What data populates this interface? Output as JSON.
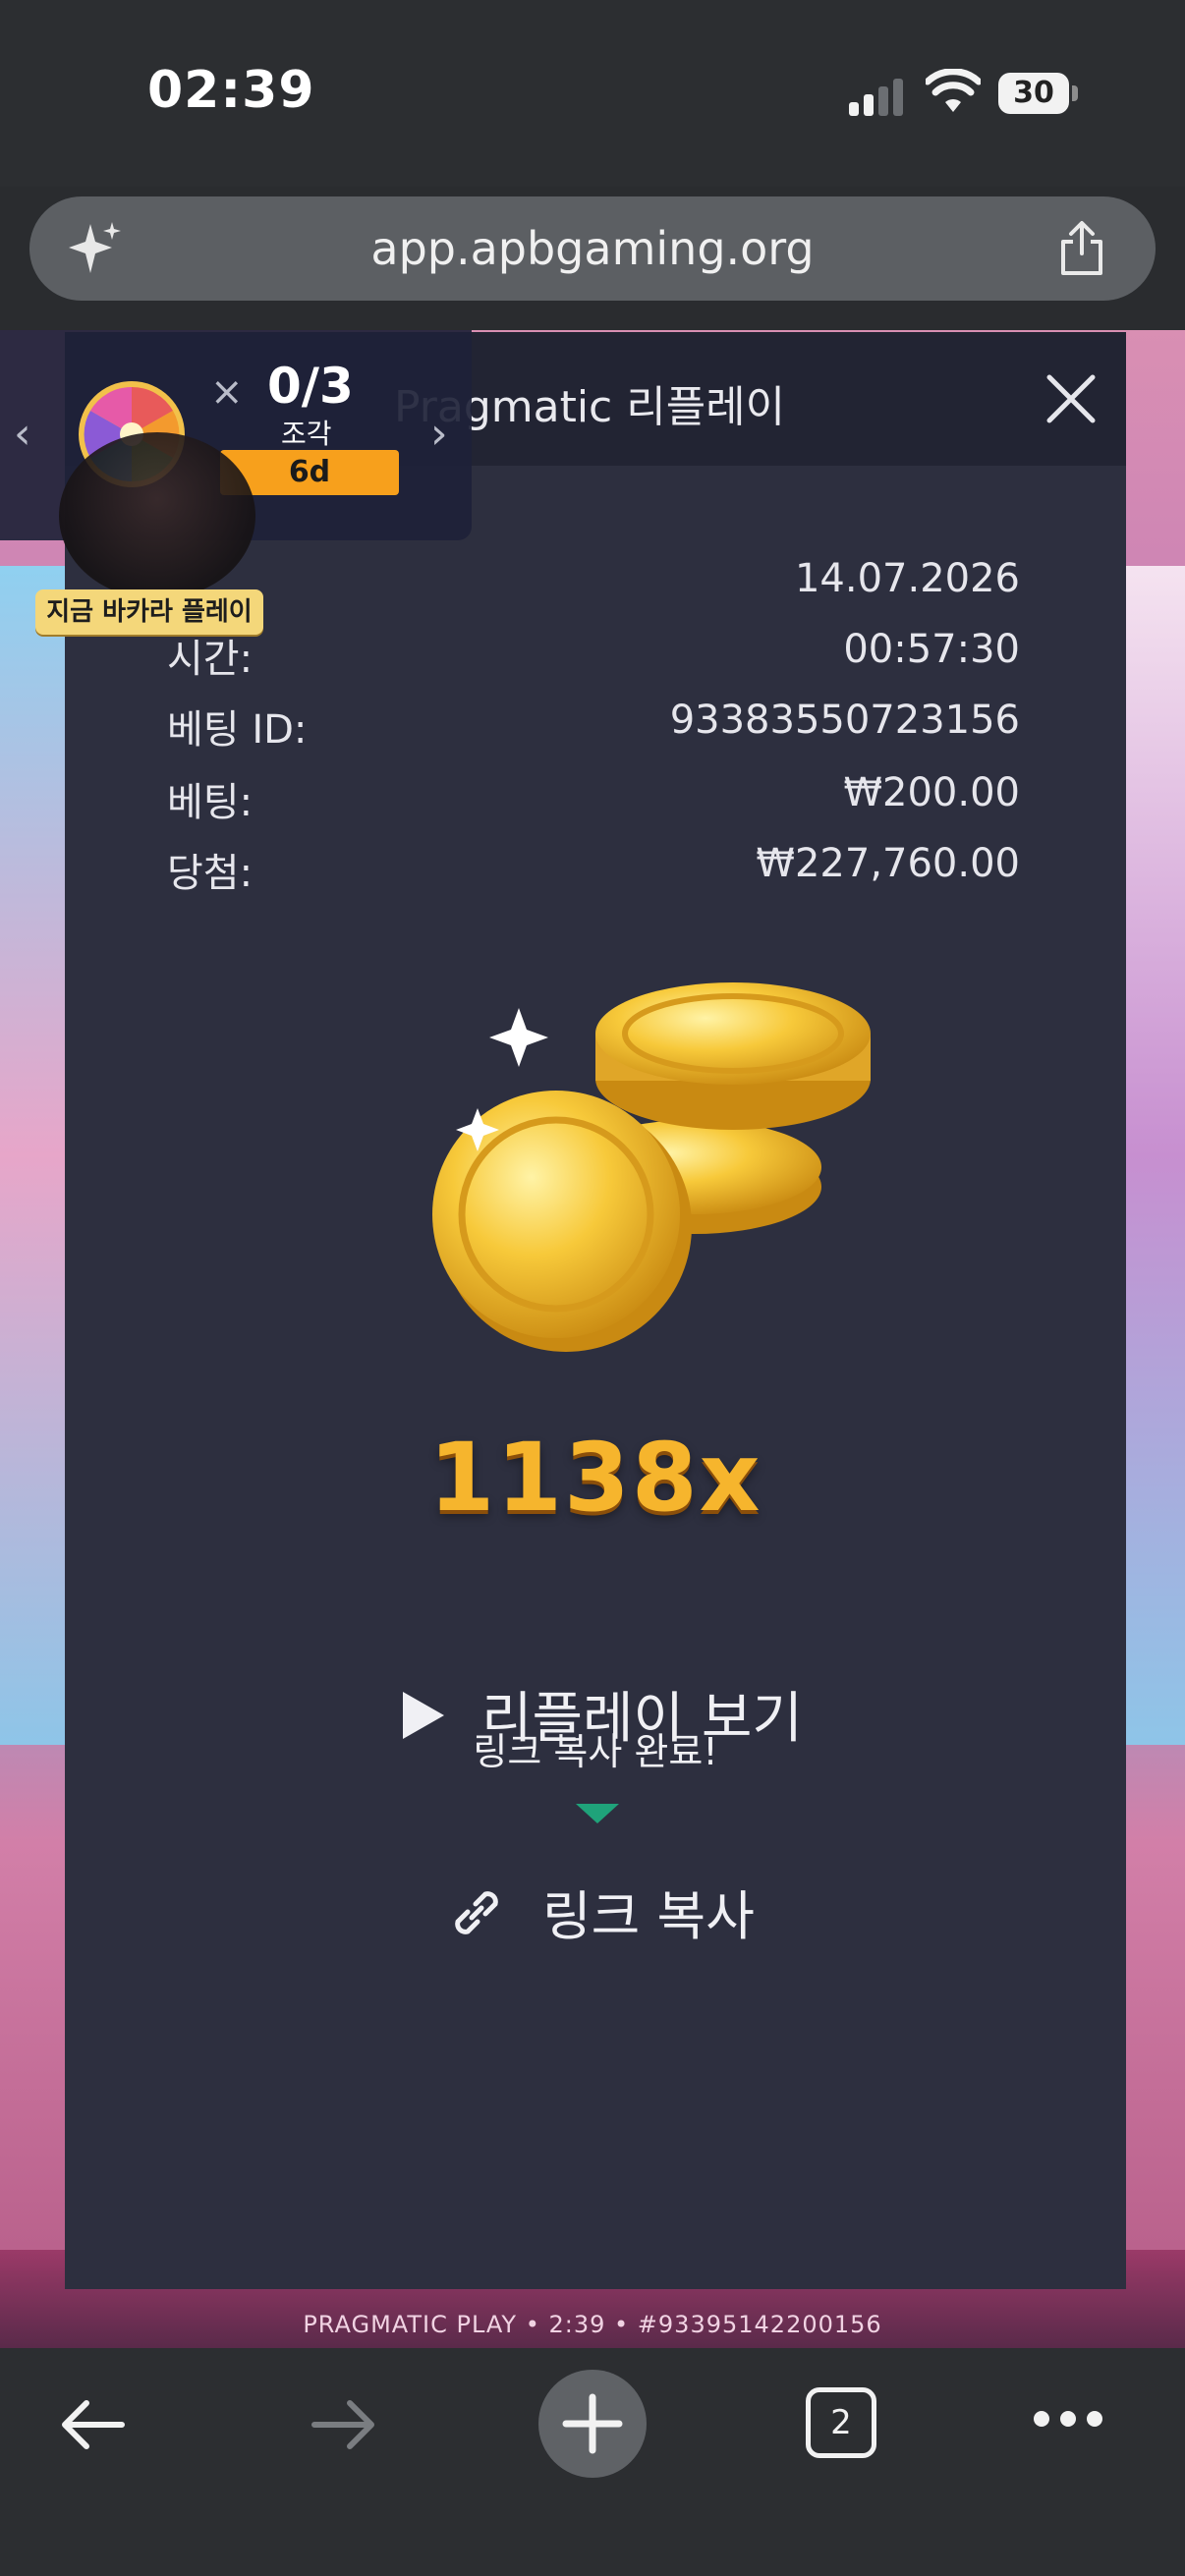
{
  "status_bar": {
    "time": "02:39",
    "battery": "30"
  },
  "browser": {
    "url": "app.apbgaming.org",
    "tab_count": "2"
  },
  "modal": {
    "title": "Pragmatic 리플레이",
    "rows": [
      {
        "label": "",
        "value": "14.07.2026"
      },
      {
        "label": "시간:",
        "value": "00:57:30"
      },
      {
        "label": "베팅 ID:",
        "value": "93383550723156"
      },
      {
        "label": "베팅:",
        "value": "₩200.00"
      },
      {
        "label": "당첨:",
        "value": "₩227,760.00"
      }
    ],
    "multiplier": "1138x",
    "replay_label": "리플레이 보기",
    "tooltip": "링크 복사 완료!",
    "copy_label": "링크 복사"
  },
  "widget": {
    "count": "0/3",
    "sub": "조각",
    "badge": "6d",
    "play_chip": "지금 바카라 플레이"
  },
  "game_footer": "PRAGMATIC PLAY • 2:39 • #93395142200156",
  "colors": {
    "accent": "#f7a01c",
    "modal_bg": "#2d2f3f",
    "tooltip_caret": "#1fa37a"
  }
}
